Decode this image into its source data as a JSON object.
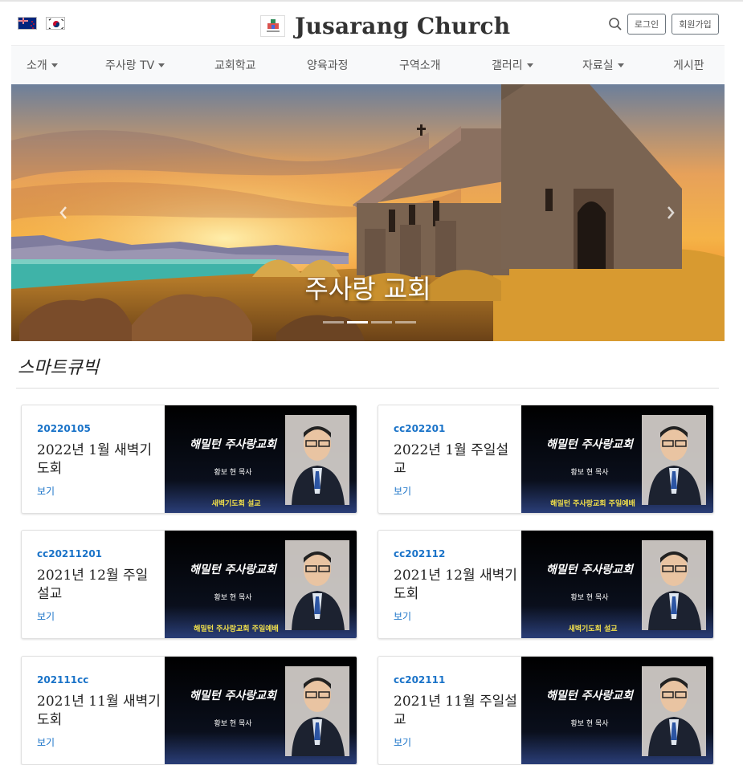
{
  "header": {
    "site_title": "Jusarang Church",
    "login_label": "로그인",
    "signup_label": "회원가입"
  },
  "nav": {
    "items": [
      {
        "label": "소개",
        "dropdown": true
      },
      {
        "label": "주사랑 TV",
        "dropdown": true
      },
      {
        "label": "교회학교",
        "dropdown": false
      },
      {
        "label": "양육과정",
        "dropdown": false
      },
      {
        "label": "구역소개",
        "dropdown": false
      },
      {
        "label": "갤러리",
        "dropdown": true
      },
      {
        "label": "자료실",
        "dropdown": true
      },
      {
        "label": "게시판",
        "dropdown": false
      }
    ]
  },
  "hero": {
    "caption": "주사랑 교회"
  },
  "section": {
    "title": "스마트큐빅"
  },
  "cards": [
    {
      "code": "20220105",
      "title": "2022년 1월 새벽기도회",
      "link": "보기",
      "thumb_title": "해밀턴 주사랑교회",
      "thumb_pastor": "황보 현 목사",
      "thumb_footer": "새벽기도회 설교"
    },
    {
      "code": "cc202201",
      "title": "2022년 1월 주일설교",
      "link": "보기",
      "thumb_title": "해밀턴 주사랑교회",
      "thumb_pastor": "황보 현 목사",
      "thumb_footer": "해밀턴 주사랑교회 주일예배"
    },
    {
      "code": "cc20211201",
      "title": "2021년 12월 주일 설교",
      "link": "보기",
      "thumb_title": "해밀턴 주사랑교회",
      "thumb_pastor": "황보 현 목사",
      "thumb_footer": "해밀턴 주사랑교회 주일예배"
    },
    {
      "code": "cc202112",
      "title": "2021년 12월 새벽기도회",
      "link": "보기",
      "thumb_title": "해밀턴 주사랑교회",
      "thumb_pastor": "황보 현 목사",
      "thumb_footer": "새벽기도회 설교"
    },
    {
      "code": "202111cc",
      "title": "2021년 11월 새벽기도회",
      "link": "보기",
      "thumb_title": "해밀턴 주사랑교회",
      "thumb_pastor": "황보 현 목사",
      "thumb_footer": ""
    },
    {
      "code": "cc202111",
      "title": "2021년 11월 주일설교",
      "link": "보기",
      "thumb_title": "해밀턴 주사랑교회",
      "thumb_pastor": "황보 현 목사",
      "thumb_footer": ""
    }
  ],
  "colors": {
    "link": "#1a73c8",
    "nav_bg": "#f8f9fa",
    "thumb_footer_text": "#f2e04a"
  },
  "icons": [
    "nz-flag-icon",
    "kr-flag-icon",
    "church-logo-icon",
    "search-icon",
    "chevron-left-icon",
    "chevron-right-icon",
    "pastor-photo-icon"
  ]
}
